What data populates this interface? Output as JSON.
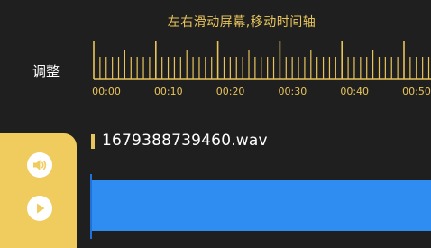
{
  "hint": "左右滑动屏幕,移动时间轴",
  "adjust_label": "调整",
  "timeline": {
    "labels": [
      "00:00",
      "00:10",
      "00:20",
      "00:30",
      "00:40",
      "00:50"
    ],
    "color": "#e8c45c"
  },
  "side_panel": {
    "color": "#f0cc5e",
    "buttons": [
      {
        "icon": "volume-icon"
      },
      {
        "icon": "play-icon"
      }
    ]
  },
  "file": {
    "name": "1679388739460.wav"
  },
  "track": {
    "color": "#2f8cf0"
  }
}
